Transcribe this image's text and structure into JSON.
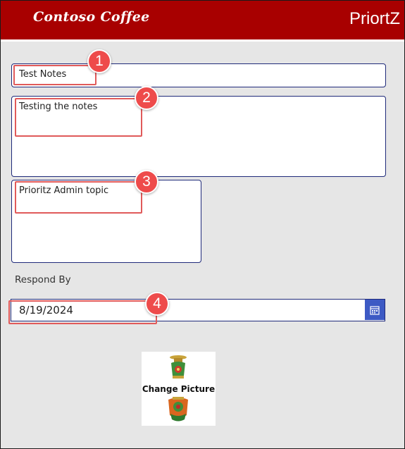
{
  "header": {
    "brand": "Contoso Coffee",
    "title": "PriortZ"
  },
  "form": {
    "title_value": "Test Notes",
    "notes_value": "Testing the notes",
    "topic_value": "Prioritz Admin topic",
    "respond_by_label": "Respond By",
    "respond_by_value": "8/19/2024",
    "change_picture_label": "Change Picture"
  },
  "callouts": [
    "1",
    "2",
    "3",
    "4"
  ],
  "icons": {
    "date_picker": "calendar-icon",
    "picture": "vase-image"
  },
  "colors": {
    "header_bg": "#a80000",
    "field_border": "#1f2a7a",
    "callout": "#ee4b4b",
    "calendar_button": "#3d5ac4"
  }
}
